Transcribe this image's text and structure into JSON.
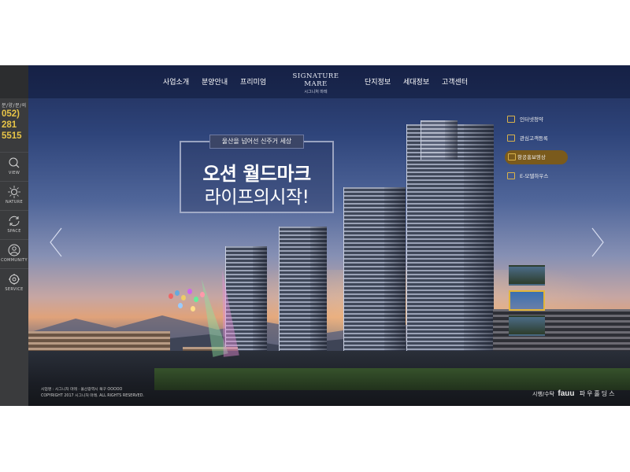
{
  "sidebar": {
    "call_label": "분/양/문/의",
    "phone_line1": "052)",
    "phone_line2": "281",
    "phone_line3": "5515",
    "items": [
      {
        "label": "VIEW",
        "icon": "magnifier-icon"
      },
      {
        "label": "NATURE",
        "icon": "sun-icon"
      },
      {
        "label": "SPACE",
        "icon": "refresh-icon"
      },
      {
        "label": "COMMUNITY",
        "icon": "person-icon"
      },
      {
        "label": "SERVICE",
        "icon": "gear-icon"
      }
    ]
  },
  "nav": {
    "items_left": [
      "사업소개",
      "분양안내",
      "프리미엄"
    ],
    "logo_line1": "SIGNATURE MARE",
    "logo_line2": "시그니처 마레",
    "items_right": [
      "단지정보",
      "세대정보",
      "고객센터"
    ]
  },
  "hero": {
    "tagline": "울산을 넘어선 신주거 세상",
    "headline_line1": "오션 월드마크",
    "headline_line2": "라이프의시작!"
  },
  "quick_menu": [
    {
      "label": "인터넷청약",
      "icon": "monitor-icon"
    },
    {
      "label": "관심고객등록",
      "icon": "document-icon"
    },
    {
      "label": "항공홍보영상",
      "icon": "play-icon",
      "active": true
    },
    {
      "label": "E-모델하우스",
      "icon": "screen-icon"
    }
  ],
  "footer": {
    "line1": "시업명 : 시그니처 마레   ·   울산광역시 북구 OOOOO",
    "line2": "COPYRIGHT   2017 시그니처 마레. ALL RIGHTS RESERVED.",
    "builder_label": "시행/수탁",
    "builder_brand": "fauu",
    "builder_name": "파우홀딩스"
  },
  "colors": {
    "accent": "#e8c547",
    "sidebar_bg": "#3a3b3d",
    "active_pill": "#7a5a1c"
  }
}
